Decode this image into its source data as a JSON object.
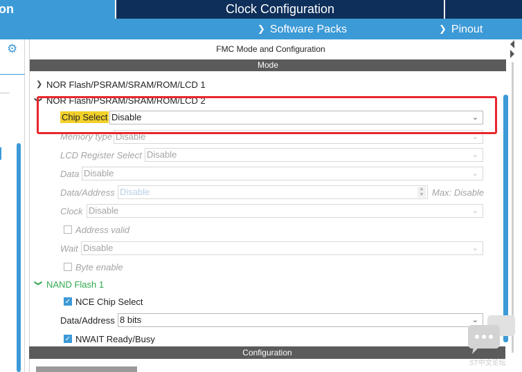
{
  "tabs": {
    "left_partial": "on",
    "center": "Clock Configuration"
  },
  "subbar": {
    "software_packs": "Software Packs",
    "pinout": "Pinout"
  },
  "panel": {
    "title": "FMC Mode and Configuration",
    "mode_header": "Mode",
    "config_header": "Configuration"
  },
  "tree": {
    "nor1": "NOR Flash/PSRAM/SRAM/ROM/LCD 1",
    "nor2": "NOR Flash/PSRAM/SRAM/ROM/LCD 2",
    "chip_select_label": "Chip Select",
    "chip_select_value": "Disable",
    "memory_type_label": "Memory type",
    "memory_type_value": "Disable",
    "lcd_reg_label": "LCD Register Select",
    "lcd_reg_value": "Disable",
    "data_label": "Data",
    "data_value": "Disable",
    "data_addr_label": "Data/Address",
    "data_addr_value": "Disable",
    "data_addr_max": "Max: Disable",
    "clock_label": "Clock",
    "clock_value": "Disable",
    "address_valid": "Address valid",
    "wait_label": "Wait",
    "wait_value": "Disable",
    "byte_enable": "Byte enable",
    "nand1": "NAND Flash 1",
    "nce_chip_select": "NCE Chip Select",
    "nand_data_addr_label": "Data/Address",
    "nand_data_addr_value": "8 bits",
    "nwait": "NWAIT Ready/Busy"
  },
  "watermark": "ST中文论坛",
  "colors": {
    "accent": "#3c9ad7",
    "navy": "#0e2f5a",
    "highlight": "#f2d02b",
    "red_box": "#e8262c",
    "section_green": "#2fa84f"
  }
}
